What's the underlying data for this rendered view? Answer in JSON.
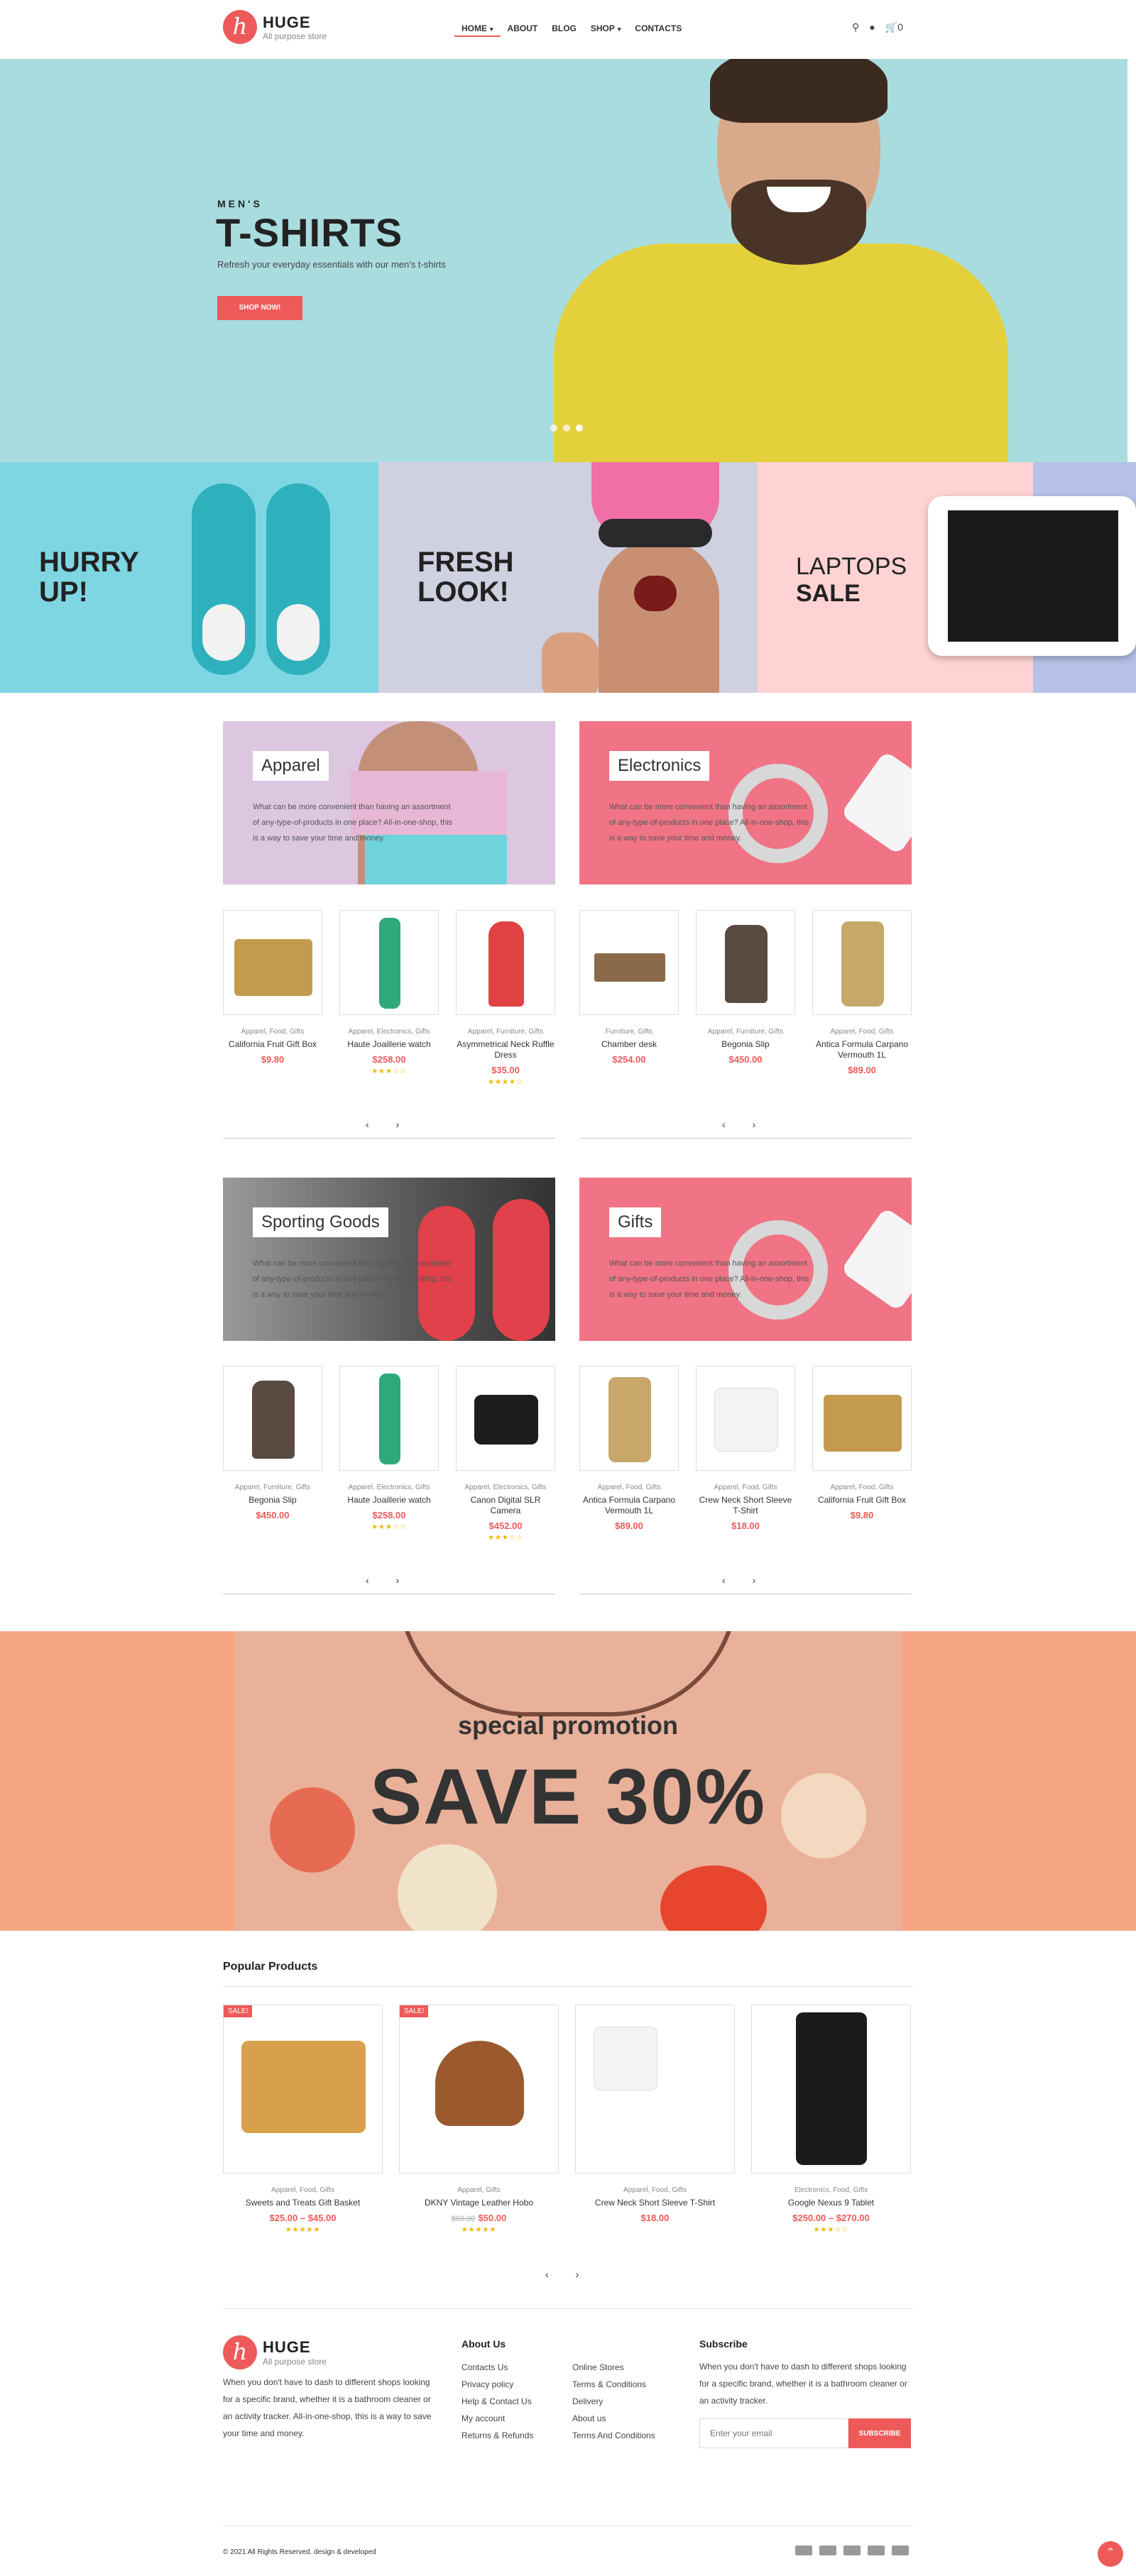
{
  "brand": {
    "name": "HUGE",
    "tagline": "All purpose store",
    "logo_letter": "h",
    "accent": "#ee5a5a"
  },
  "nav": {
    "items": [
      "HOME",
      "ABOUT",
      "BLOG",
      "SHOP",
      "CONTACTS"
    ],
    "active": "HOME",
    "cart_count": "0"
  },
  "hero": {
    "pretitle": "MEN'S",
    "title": "T-SHIRTS",
    "subtitle": "Refresh your everyday essentials with our men's t-shirts",
    "button": "SHOP NOW!"
  },
  "promos": [
    {
      "line1": "HURRY",
      "line2": "UP!",
      "bg": "#7fd6e3"
    },
    {
      "line1": "FRESH",
      "line2": "LOOK!",
      "bg": "#cfd0e0"
    },
    {
      "line1": "LAPTOPS",
      "line2": "SALE",
      "bg": "#ffd3d3"
    }
  ],
  "categories": [
    {
      "label": "Apparel",
      "text": "What can be more convenient than having an assortment of any-type-of-products in one place? All-in-one-shop, this is a way to save your time and money."
    },
    {
      "label": "Electronics",
      "text": "What can be more convenient than having an assortment of any-type-of-products in one place? All-in-one-shop, this is a way to save your time and money."
    },
    {
      "label": "Sporting Goods",
      "text": "What can be more convenient than having an assortment of any-type-of-products in one place? All-in-one-shop, this is a way to save your time and money."
    },
    {
      "label": "Gifts",
      "text": "What can be more convenient than having an assortment of any-type-of-products in one place? All-in-one-shop, this is a way to save your time and money."
    }
  ],
  "products_row1": [
    {
      "cats": "Apparel, Food, Gifts",
      "name": "California Fruit Gift Box",
      "price": "$9.80",
      "stars": ""
    },
    {
      "cats": "Apparel, Electronics, Gifts",
      "name": "Haute Joaillerie watch",
      "price": "$258.00",
      "stars": "★★★☆☆"
    },
    {
      "cats": "Apparel, Furniture, Gifts",
      "name": "Asymmetrical Neck Ruffle Dress",
      "price": "$35.00",
      "stars": "★★★★☆"
    },
    {
      "cats": "Furniture, Gifts",
      "name": "Chamber desk",
      "price": "$254.00",
      "stars": ""
    },
    {
      "cats": "Apparel, Furniture, Gifts",
      "name": "Begonia Slip",
      "price": "$450.00",
      "stars": ""
    },
    {
      "cats": "Apparel, Food, Gifts",
      "name": "Antica Formula Carpano Vermouth 1L",
      "price": "$89.00",
      "stars": ""
    }
  ],
  "products_row2": [
    {
      "cats": "Apparel, Furniture, Gifts",
      "name": "Begonia Slip",
      "price": "$450.00",
      "stars": ""
    },
    {
      "cats": "Apparel, Electronics, Gifts",
      "name": "Haute Joaillerie watch",
      "price": "$258.00",
      "stars": "★★★☆☆"
    },
    {
      "cats": "Apparel, Electronics, Gifts",
      "name": "Canon Digital SLR Camera",
      "price": "$452.00",
      "stars": "★★★☆☆"
    },
    {
      "cats": "Apparel, Food, Gifts",
      "name": "Antica Formula Carpano Vermouth 1L",
      "price": "$89.00",
      "stars": ""
    },
    {
      "cats": "Apparel, Food, Gifts",
      "name": "Crew Neck Short Sleeve T-Shirt",
      "price": "$18.00",
      "stars": ""
    },
    {
      "cats": "Apparel, Food, Gifts",
      "name": "California Fruit Gift Box",
      "price": "$9.80",
      "stars": ""
    }
  ],
  "promotion": {
    "title": "special promotion",
    "save": "SAVE 30%"
  },
  "popular": {
    "title": "Popular Products",
    "items": [
      {
        "badge": "SALE!",
        "cats": "Apparel, Food, Gifts",
        "name": "Sweets and Treats Gift Basket",
        "price": "$25.00 – $45.00",
        "old_price": "",
        "stars": "★★★★★"
      },
      {
        "badge": "SALE!",
        "cats": "Apparel, Gifts",
        "name": "DKNY Vintage Leather Hobo",
        "price": "$50.00",
        "old_price": "$60.00",
        "stars": "★★★★★"
      },
      {
        "badge": "",
        "cats": "Apparel, Food, Gifts",
        "name": "Crew Neck Short Sleeve T-Shirt",
        "price": "$18.00",
        "old_price": "",
        "stars": ""
      },
      {
        "badge": "",
        "cats": "Electronics, Food, Gifts",
        "name": "Google Nexus 9 Tablet",
        "price": "$250.00 – $270.00",
        "old_price": "",
        "stars": "★★★☆☆"
      }
    ]
  },
  "footer": {
    "about_text": "When you don't have to dash to different shops looking for a specific brand, whether it is a bathroom cleaner or an activity tracker. All-in-one-shop, this is a way to save your time and money.",
    "about_title": "About Us",
    "col1": [
      "Contacts Us",
      "Privacy policy",
      "Help & Contact Us",
      "My account",
      "Returns & Refunds"
    ],
    "col2": [
      "Online Stores",
      "Terms & Conditions",
      "Delivery",
      "About us",
      "Terms And Conditions"
    ],
    "subscribe_title": "Subscribe",
    "subscribe_text": "When you don't have to dash to different shops looking for a specific brand, whether it is a bathroom cleaner or an activity tracker.",
    "email_placeholder": "Enter your email",
    "subscribe_button": "SUBSCRIBE",
    "copyright": "© 2021 All Rights Reserved. design & developed"
  }
}
